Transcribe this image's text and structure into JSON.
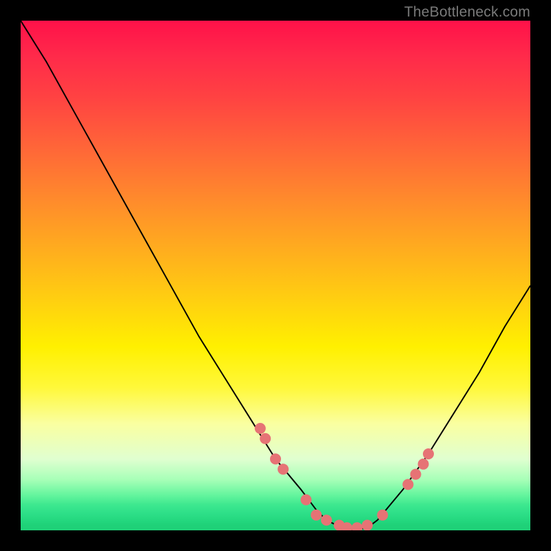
{
  "watermark": "TheBottleneck.com",
  "chart_data": {
    "type": "line",
    "title": "",
    "xlabel": "",
    "ylabel": "",
    "xlim": [
      0,
      100
    ],
    "ylim": [
      0,
      100
    ],
    "series": [
      {
        "name": "bottleneck-curve",
        "x": [
          0,
          5,
          10,
          15,
          20,
          25,
          30,
          35,
          40,
          45,
          50,
          55,
          58,
          60,
          62,
          65,
          68,
          70,
          75,
          80,
          85,
          90,
          95,
          100
        ],
        "values": [
          100,
          92,
          83,
          74,
          65,
          56,
          47,
          38,
          30,
          22,
          14,
          8,
          4,
          2,
          1,
          0,
          0.5,
          2,
          8,
          15,
          23,
          31,
          40,
          48
        ]
      }
    ],
    "markers": {
      "name": "highlight-dots",
      "color": "#e67375",
      "x": [
        47,
        48,
        50,
        51.5,
        56,
        58,
        60,
        62.5,
        64,
        66,
        68,
        71,
        76,
        77.5,
        79,
        80
      ],
      "values": [
        20,
        18,
        14,
        12,
        6,
        3,
        2,
        1,
        0.5,
        0.5,
        1,
        3,
        9,
        11,
        13,
        15
      ]
    }
  }
}
